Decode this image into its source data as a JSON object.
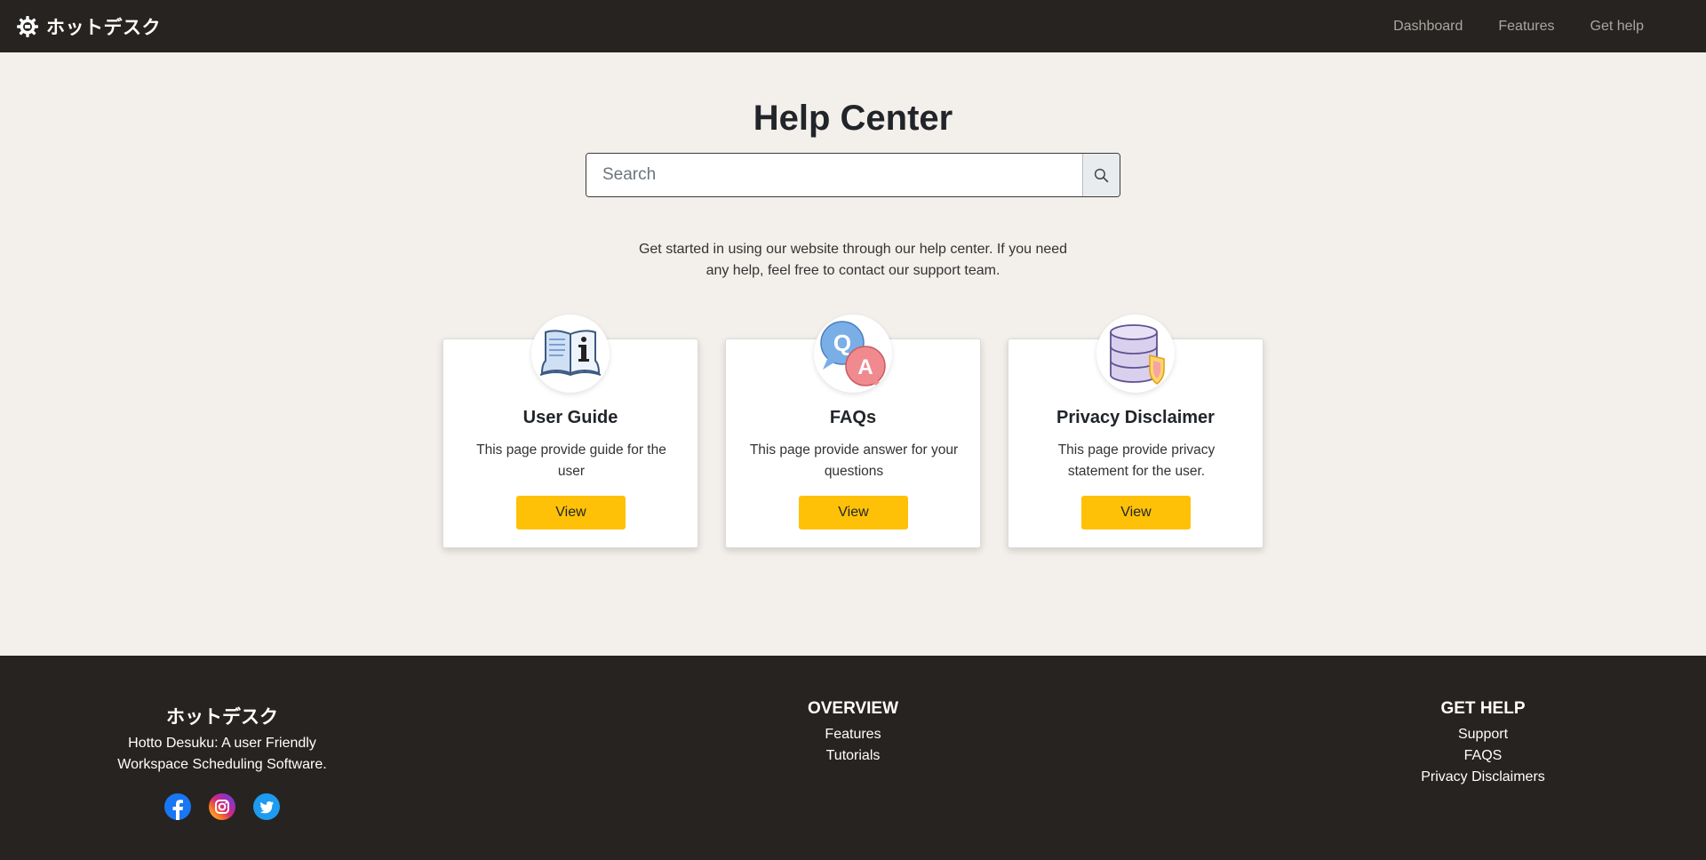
{
  "navbar": {
    "brand": "ホットデスク",
    "links": [
      "Dashboard",
      "Features",
      "Get help"
    ]
  },
  "main": {
    "title": "Help Center",
    "search_placeholder": "Search",
    "intro_line1": "Get started in using our website through our help center. If you need",
    "intro_line2": "any help, feel free to contact our support team.",
    "cards": [
      {
        "icon": "book-info-icon",
        "title": "User Guide",
        "text": "This page provide guide for the user",
        "button": "View"
      },
      {
        "icon": "qa-bubbles-icon",
        "title": "FAQs",
        "text": "This page provide answer for your questions",
        "button": "View"
      },
      {
        "icon": "database-shield-icon",
        "title": "Privacy Disclaimer",
        "text": "This page provide privacy statement for the user.",
        "button": "View"
      }
    ]
  },
  "footer": {
    "brand_title": "ホットデスク",
    "brand_text": "Hotto Desuku: A user Friendly Workspace Scheduling Software.",
    "socials": [
      "facebook-icon",
      "instagram-icon",
      "twitter-icon"
    ],
    "overview": {
      "heading": "OVERVIEW",
      "links": [
        "Features",
        "Tutorials"
      ]
    },
    "get_help": {
      "heading": "GET HELP",
      "links": [
        "Support",
        "FAQS",
        "Privacy Disclaimers"
      ]
    }
  },
  "colors": {
    "nav_bg": "#272320",
    "page_bg": "#f3efeb",
    "accent_button": "#ffc107"
  }
}
